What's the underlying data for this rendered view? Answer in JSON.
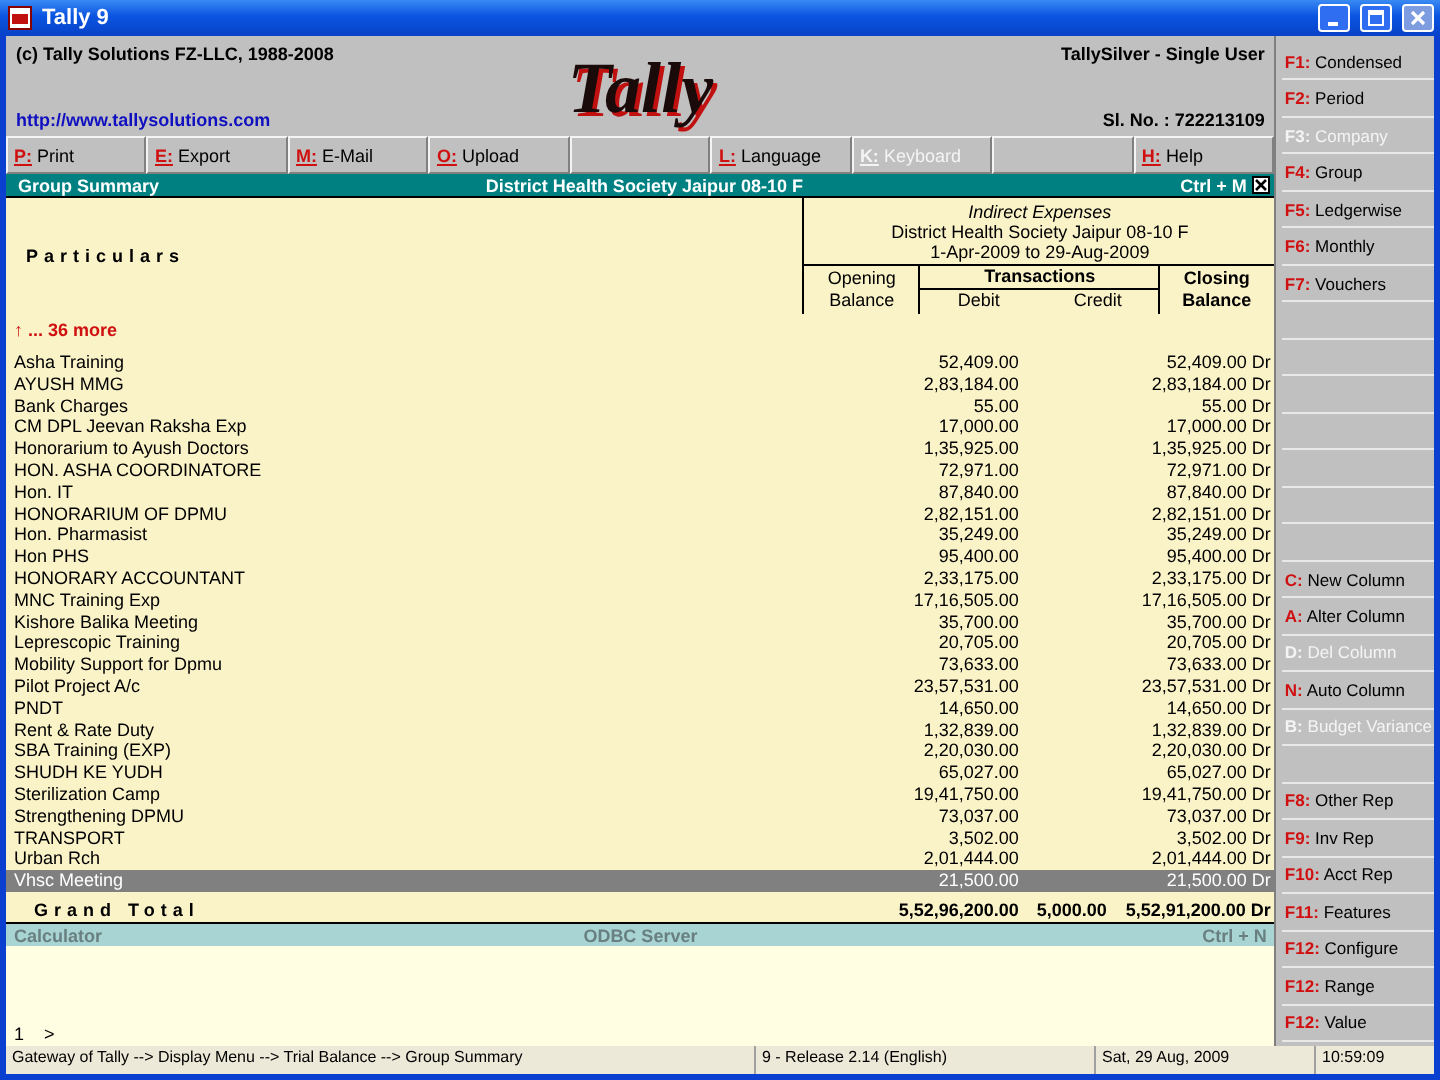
{
  "window": {
    "title": "Tally 9"
  },
  "header": {
    "copyright": "(c) Tally Solutions FZ-LLC, 1988-2008",
    "logo": "Tally",
    "website": "http://www.tallysolutions.com",
    "edition": "TallySilver - Single User",
    "serial": "Sl. No. : 722213109"
  },
  "top_buttons": [
    {
      "kind": "button",
      "key": "P:",
      "label": "Print",
      "disabled": false
    },
    {
      "kind": "button",
      "key": "E:",
      "label": "Export",
      "disabled": false
    },
    {
      "kind": "button",
      "key": "M:",
      "label": "E-Mail",
      "disabled": false
    },
    {
      "kind": "button",
      "key": "O:",
      "label": "Upload",
      "disabled": false
    },
    {
      "kind": "blank"
    },
    {
      "kind": "button",
      "key": "L:",
      "label": "Language",
      "disabled": false
    },
    {
      "kind": "button",
      "key": "K:",
      "label": "Keyboard",
      "disabled": true
    },
    {
      "kind": "blank"
    },
    {
      "kind": "button",
      "key": "H:",
      "label": "Help",
      "disabled": false
    }
  ],
  "report_bar": {
    "title": "Group Summary",
    "company": "District Health Society Jaipur 08-10 F",
    "shortcut": "Ctrl + M"
  },
  "table": {
    "particulars_heading": "Particulars",
    "group": "Indirect Expenses",
    "company": "District Health Society Jaipur 08-10 F",
    "period": "1-Apr-2009 to 29-Aug-2009",
    "opening_heading": "Opening Balance",
    "transactions_heading": "Transactions",
    "debit_heading": "Debit",
    "credit_heading": "Credit",
    "closing_heading": "Closing Balance",
    "more": "↑ ... 36 more",
    "rows": [
      {
        "name": "Asha Training",
        "debit": "52,409.00",
        "closing": "52,409.00 Dr",
        "selected": false
      },
      {
        "name": "AYUSH MMG",
        "debit": "2,83,184.00",
        "closing": "2,83,184.00 Dr",
        "selected": false
      },
      {
        "name": "Bank Charges",
        "debit": "55.00",
        "closing": "55.00 Dr",
        "selected": false
      },
      {
        "name": "CM DPL Jeevan Raksha Exp",
        "debit": "17,000.00",
        "closing": "17,000.00 Dr",
        "selected": false
      },
      {
        "name": "Honorarium to Ayush Doctors",
        "debit": "1,35,925.00",
        "closing": "1,35,925.00 Dr",
        "selected": false
      },
      {
        "name": "HON. ASHA COORDINATORE",
        "debit": "72,971.00",
        "closing": "72,971.00 Dr",
        "selected": false
      },
      {
        "name": "Hon. IT",
        "debit": "87,840.00",
        "closing": "87,840.00 Dr",
        "selected": false
      },
      {
        "name": "HONORARIUM OF DPMU",
        "debit": "2,82,151.00",
        "closing": "2,82,151.00 Dr",
        "selected": false
      },
      {
        "name": "Hon. Pharmasist",
        "debit": "35,249.00",
        "closing": "35,249.00 Dr",
        "selected": false
      },
      {
        "name": "Hon PHS",
        "debit": "95,400.00",
        "closing": "95,400.00 Dr",
        "selected": false
      },
      {
        "name": "HONORARY ACCOUNTANT",
        "debit": "2,33,175.00",
        "closing": "2,33,175.00 Dr",
        "selected": false
      },
      {
        "name": "MNC Training Exp",
        "debit": "17,16,505.00",
        "closing": "17,16,505.00 Dr",
        "selected": false
      },
      {
        "name": "Kishore Balika Meeting",
        "debit": "35,700.00",
        "closing": "35,700.00 Dr",
        "selected": false
      },
      {
        "name": "Leprescopic Training",
        "debit": "20,705.00",
        "closing": "20,705.00 Dr",
        "selected": false
      },
      {
        "name": "Mobility Support for Dpmu",
        "debit": "73,633.00",
        "closing": "73,633.00 Dr",
        "selected": false
      },
      {
        "name": "Pilot Project A/c",
        "debit": "23,57,531.00",
        "closing": "23,57,531.00 Dr",
        "selected": false
      },
      {
        "name": "PNDT",
        "debit": "14,650.00",
        "closing": "14,650.00 Dr",
        "selected": false
      },
      {
        "name": "Rent & Rate Duty",
        "debit": "1,32,839.00",
        "closing": "1,32,839.00 Dr",
        "selected": false
      },
      {
        "name": "SBA Training (EXP)",
        "debit": "2,20,030.00",
        "closing": "2,20,030.00 Dr",
        "selected": false
      },
      {
        "name": "SHUDH KE YUDH",
        "debit": "65,027.00",
        "closing": "65,027.00 Dr",
        "selected": false
      },
      {
        "name": "Sterilization Camp",
        "debit": "19,41,750.00",
        "closing": "19,41,750.00 Dr",
        "selected": false
      },
      {
        "name": "Strengthening DPMU",
        "debit": "73,037.00",
        "closing": "73,037.00 Dr",
        "selected": false
      },
      {
        "name": "TRANSPORT",
        "debit": "3,502.00",
        "closing": "3,502.00 Dr",
        "selected": false
      },
      {
        "name": "Urban Rch",
        "debit": "2,01,444.00",
        "closing": "2,01,444.00 Dr",
        "selected": false
      },
      {
        "name": "Vhsc Meeting",
        "debit": "21,500.00",
        "closing": "21,500.00 Dr",
        "selected": true
      }
    ],
    "total": {
      "label": "Grand Total",
      "debit": "5,52,96,200.00",
      "credit": "5,000.00",
      "closing": "5,52,91,200.00 Dr"
    }
  },
  "calculator": {
    "title": "Calculator",
    "server": "ODBC Server",
    "shortcut": "Ctrl + N",
    "line": "1",
    "prompt": ">"
  },
  "side_buttons": [
    {
      "kind": "button",
      "key": "F1:",
      "label": "Condensed",
      "disabled": false
    },
    {
      "kind": "button",
      "key": "F2:",
      "label": "Period",
      "disabled": false
    },
    {
      "kind": "button",
      "key": "F3:",
      "label": "Company",
      "disabled": true
    },
    {
      "kind": "button",
      "key": "F4:",
      "label": "Group",
      "disabled": false
    },
    {
      "kind": "button",
      "key": "F5:",
      "label": "Ledgerwise",
      "disabled": false
    },
    {
      "kind": "button",
      "key": "F6:",
      "label": "Monthly",
      "disabled": false
    },
    {
      "kind": "button",
      "key": "F7:",
      "label": "Vouchers",
      "disabled": false
    },
    {
      "kind": "blank"
    },
    {
      "kind": "blank"
    },
    {
      "kind": "blank"
    },
    {
      "kind": "blank"
    },
    {
      "kind": "blank"
    },
    {
      "kind": "blank"
    },
    {
      "kind": "blank"
    },
    {
      "kind": "button",
      "key": "C:",
      "label": "New Column",
      "disabled": false
    },
    {
      "kind": "button",
      "key": "A:",
      "label": "Alter Column",
      "disabled": false
    },
    {
      "kind": "button",
      "key": "D:",
      "label": "Del Column",
      "disabled": true
    },
    {
      "kind": "button",
      "key": "N:",
      "label": "Auto Column",
      "disabled": false
    },
    {
      "kind": "button",
      "key": "B:",
      "label": "Budget Variance",
      "disabled": true
    },
    {
      "kind": "blank"
    },
    {
      "kind": "button",
      "key": "F8:",
      "label": "Other Rep",
      "disabled": false
    },
    {
      "kind": "button",
      "key": "F9:",
      "label": "Inv Rep",
      "disabled": false
    },
    {
      "kind": "button",
      "key": "F10:",
      "label": "Acct Rep",
      "disabled": false
    },
    {
      "kind": "button",
      "key": "F11:",
      "label": "Features",
      "disabled": false
    },
    {
      "kind": "button",
      "key": "F12:",
      "label": "Configure",
      "disabled": false
    },
    {
      "kind": "button",
      "key": "F12:",
      "label": "Range",
      "disabled": false
    },
    {
      "kind": "button",
      "key": "F12:",
      "label": "Value",
      "disabled": false
    }
  ],
  "status_bar": {
    "path": "Gateway of Tally --> Display Menu --> Trial Balance --> Group Summary",
    "release": "9 - Release 2.14 (English)",
    "date": "Sat, 29 Aug, 2009",
    "time": "10:59:09"
  }
}
